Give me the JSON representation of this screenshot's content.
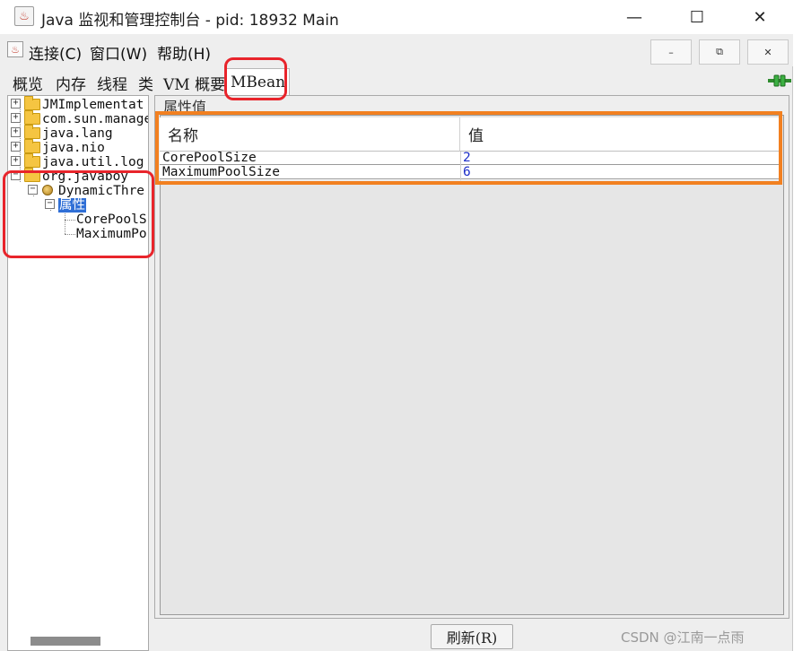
{
  "window": {
    "title": "Java 监视和管理控制台 - pid: 18932 Main",
    "minimize_glyph": "—",
    "maximize_glyph": "☐",
    "close_glyph": "✕"
  },
  "menu": {
    "items": [
      "连接(C)",
      "窗口(W)",
      "帮助(H)"
    ],
    "inner_minimize": "–",
    "inner_restore": "⧉",
    "inner_close": "✕"
  },
  "tabs": [
    "概览",
    "内存",
    "线程",
    "类",
    "VM 概要",
    "MBean"
  ],
  "active_tab": "MBean",
  "tree": {
    "nodes": [
      {
        "label": "JMImplementat",
        "expander": "+",
        "icon": "folder-icon"
      },
      {
        "label": "com.sun.manage",
        "expander": "+",
        "icon": "folder-icon"
      },
      {
        "label": "java.lang",
        "expander": "+",
        "icon": "folder-icon"
      },
      {
        "label": "java.nio",
        "expander": "+",
        "icon": "folder-icon"
      },
      {
        "label": "java.util.log",
        "expander": "+",
        "icon": "folder-icon"
      },
      {
        "label": "org.javaboy",
        "expander": "−",
        "icon": "folder-icon"
      },
      {
        "label": "DynamicThre",
        "expander": "−",
        "icon": "bean-icon"
      },
      {
        "label": "属性",
        "expander": "−",
        "icon": ""
      },
      {
        "label": "CorePoolS",
        "expander": "",
        "icon": ""
      },
      {
        "label": "MaximumPo",
        "expander": "",
        "icon": ""
      }
    ]
  },
  "attributes": {
    "section_title": "属性值",
    "columns": [
      "名称",
      "值"
    ],
    "rows": [
      {
        "name": "CorePoolSize",
        "value": "2"
      },
      {
        "name": "MaximumPoolSize",
        "value": "6"
      }
    ]
  },
  "footer": {
    "refresh_label": "刷新(R)",
    "watermark": "CSDN @江南一点雨"
  },
  "colors": {
    "annotation_red": "#e8242b",
    "annotation_orange": "#f28020",
    "selection": "#2f6fd6",
    "value_blue": "#1d2fc8"
  }
}
